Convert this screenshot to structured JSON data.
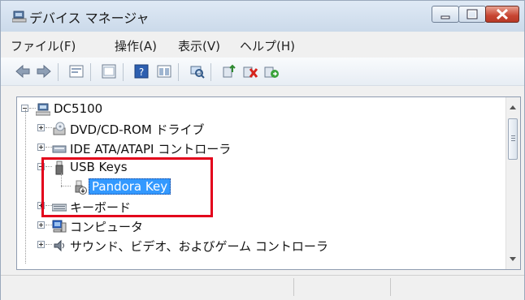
{
  "window": {
    "title": "デバイス マネージャ"
  },
  "menu": [
    "ファイル(F)",
    "操作(A)",
    "表示(V)",
    "ヘルプ(H)"
  ],
  "toolbar": {
    "icons": [
      "back-icon",
      "forward-icon",
      "properties-icon",
      "console-icon",
      "help-icon",
      "view-icon",
      "scan-hardware-icon",
      "update-driver-icon",
      "uninstall-icon",
      "enable-icon"
    ]
  },
  "tree": {
    "root": "DC5100",
    "items": [
      {
        "label": "DVD/CD-ROM ドライブ"
      },
      {
        "label": "IDE ATA/ATAPI コントローラ"
      },
      {
        "label": "USB Keys"
      },
      {
        "label": "Pandora Key"
      },
      {
        "label": "キーボード"
      },
      {
        "label": "コンピュータ"
      },
      {
        "label": "サウンド、ビデオ、およびゲーム コントローラ"
      }
    ]
  },
  "colors": {
    "highlight": "#e3001b",
    "selection": "#3399ff"
  }
}
